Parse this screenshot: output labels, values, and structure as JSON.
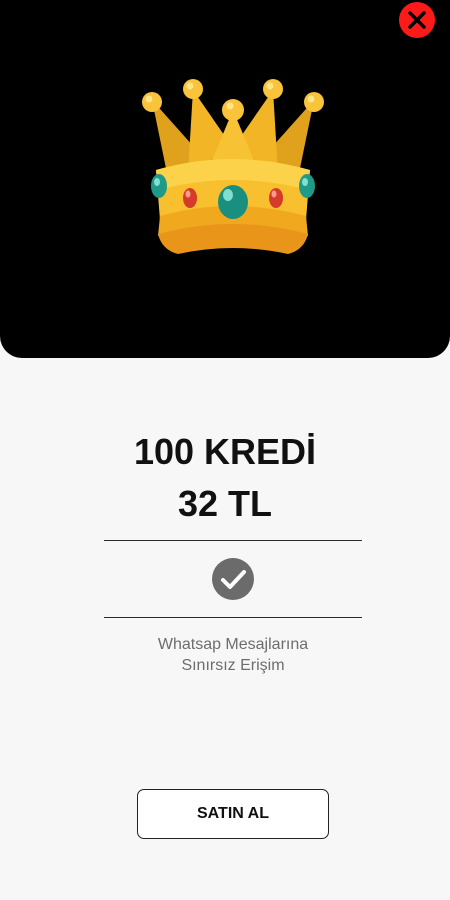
{
  "dialog": {
    "close_icon": "close-icon",
    "hero_icon": "crown-icon",
    "colors": {
      "hero_background": "#000000",
      "close_button": "#ff1a1a",
      "page_background": "#f7f7f7",
      "check_circle": "#6b6b6b"
    }
  },
  "product": {
    "title": "100 KREDİ",
    "price": "32 TL",
    "feature_icon": "checkmark-circle-icon",
    "feature_line1": "Whatsap Mesajlarına",
    "feature_line2": "Sınırsız Erişim"
  },
  "actions": {
    "buy_label": "SATIN AL"
  }
}
